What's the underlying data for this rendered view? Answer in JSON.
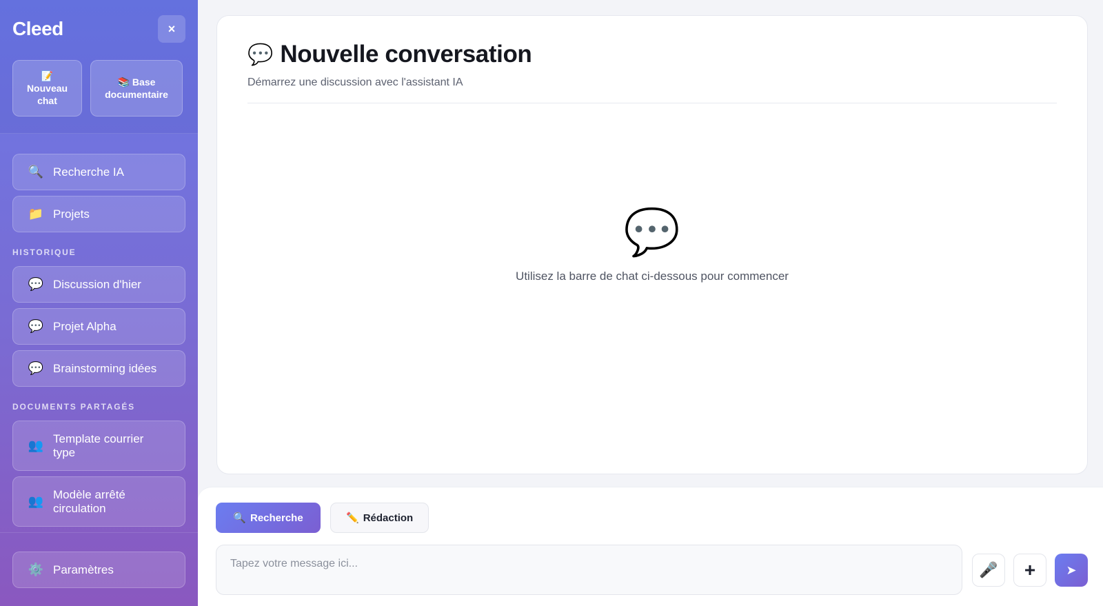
{
  "sidebar": {
    "logo": "Cleed",
    "close_icon": "×",
    "quick_actions": [
      {
        "icon": "📝",
        "label_line1": "Nouveau",
        "label_line2": "chat"
      },
      {
        "icon": "📚",
        "label_line1": "Base",
        "label_line2": "documentaire"
      }
    ],
    "nav": [
      {
        "icon": "🔍",
        "label": "Recherche IA"
      },
      {
        "icon": "📁",
        "label": "Projets"
      }
    ],
    "history_label": "HISTORIQUE",
    "history": [
      {
        "icon": "💬",
        "label": "Discussion d'hier"
      },
      {
        "icon": "💬",
        "label": "Projet Alpha"
      },
      {
        "icon": "💬",
        "label": "Brainstorming idées"
      }
    ],
    "shared_label": "DOCUMENTS PARTAGÉS",
    "shared": [
      {
        "icon": "👥",
        "label_line1": "Template courrier",
        "label_line2": "type"
      },
      {
        "icon": "👥",
        "label_line1": "Modèle arrêté",
        "label_line2": "circulation"
      }
    ],
    "settings": {
      "icon": "⚙️",
      "label": "Paramètres"
    }
  },
  "main": {
    "title_icon": "💬",
    "title": "Nouvelle conversation",
    "subtitle": "Démarrez une discussion avec l'assistant IA",
    "empty_icon": "💬",
    "empty_text": "Utilisez la barre de chat ci-dessous pour commencer"
  },
  "composer": {
    "modes": [
      {
        "icon": "🔍",
        "label": "Recherche",
        "active": true
      },
      {
        "icon": "✏️",
        "label": "Rédaction",
        "active": false
      }
    ],
    "placeholder": "Tapez votre message ici...",
    "mic_icon": "🎤",
    "plus_icon": "+",
    "send_icon": "➤"
  }
}
